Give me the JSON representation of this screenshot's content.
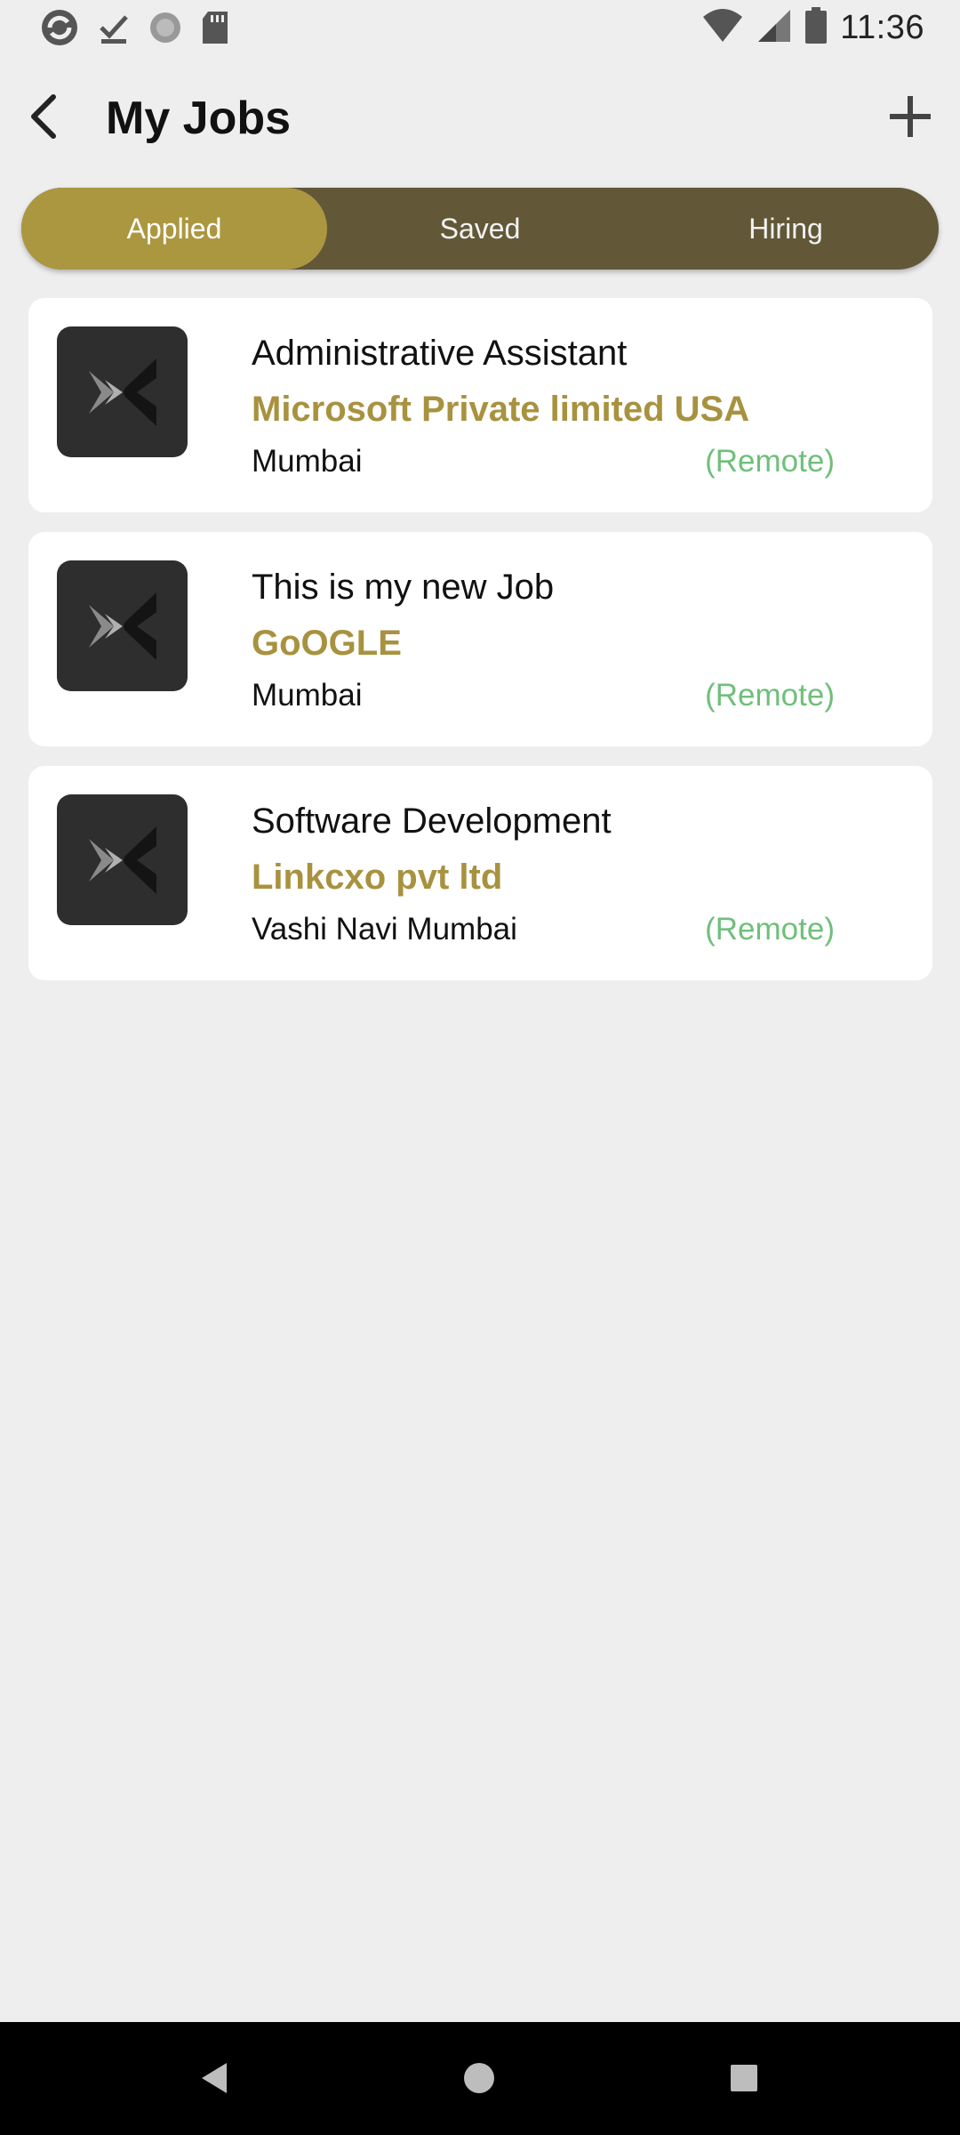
{
  "status_bar": {
    "time": "11:36",
    "left_icons": [
      "sync-icon",
      "download-done-icon",
      "loading-icon",
      "sd-card-icon"
    ],
    "right_icons": [
      "wifi-icon",
      "signal-icon",
      "battery-icon"
    ]
  },
  "header": {
    "title": "My Jobs"
  },
  "tabs": [
    {
      "label": "Applied",
      "active": true
    },
    {
      "label": "Saved",
      "active": false
    },
    {
      "label": "Hiring",
      "active": false
    }
  ],
  "jobs": [
    {
      "title": "Administrative Assistant",
      "company": "Microsoft Private limited USA",
      "location": "Mumbai",
      "mode": "(Remote)"
    },
    {
      "title": "This is my new Job",
      "company": "GoOGLE",
      "location": "Mumbai",
      "mode": "(Remote)"
    },
    {
      "title": "Software Development",
      "company": "Linkcxo pvt ltd",
      "location": "Vashi Navi Mumbai",
      "mode": "(Remote)"
    }
  ],
  "colors": {
    "accent": "#ac9741",
    "tab_bg": "#625838",
    "company_text": "#a8923f",
    "remote_text": "#6fbf7b",
    "background": "#eeeeee"
  }
}
